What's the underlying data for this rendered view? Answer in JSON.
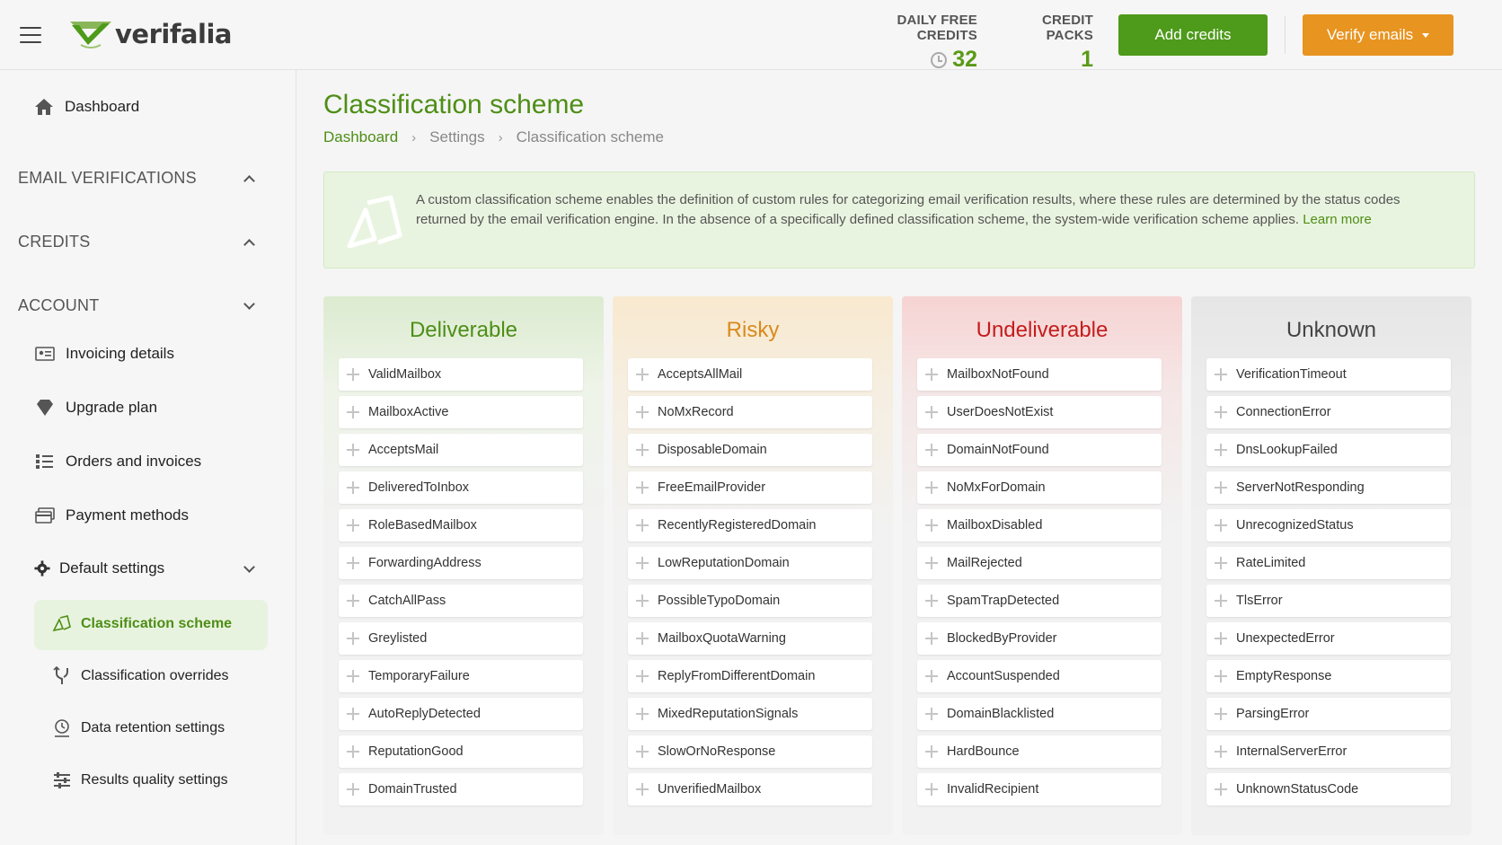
{
  "header": {
    "logo_text": "verifalia",
    "daily_credits_label": "DAILY FREE CREDITS",
    "daily_credits_value": "32",
    "credit_packs_label": "CREDIT PACKS",
    "credit_packs_value": "1",
    "add_credits_label": "Add credits",
    "verify_emails_label": "Verify emails",
    "accent_green": "#4e9a1a",
    "accent_orange": "#e89420"
  },
  "sidebar": {
    "dashboard": "Dashboard",
    "sections": {
      "email_verifications": "EMAIL VERIFICATIONS",
      "credits": "CREDITS",
      "account": "ACCOUNT"
    },
    "account_items": {
      "invoicing": "Invoicing details",
      "upgrade": "Upgrade plan",
      "orders": "Orders and invoices",
      "payment": "Payment methods",
      "default_settings": "Default settings"
    },
    "settings_items": {
      "classification_scheme": "Classification scheme",
      "classification_overrides": "Classification overrides",
      "data_retention": "Data retention settings",
      "results_quality": "Results quality settings"
    }
  },
  "main": {
    "title": "Classification scheme",
    "breadcrumb": [
      "Dashboard",
      "Settings",
      "Classification scheme"
    ],
    "info_text": "A custom classification scheme enables the definition of custom rules for categorizing email verification results, where these rules are determined by the status codes returned by the email verification engine. In the absence of a specifically defined classification scheme, the system-wide verification scheme applies.",
    "learn_more": "Learn more"
  },
  "columns": [
    {
      "title": "Deliverable",
      "color": "#4e8e16",
      "items": [
        "ValidMailbox",
        "MailboxActive",
        "AcceptsMail",
        "DeliveredToInbox",
        "RoleBasedMailbox",
        "ForwardingAddress",
        "CatchAllPass",
        "Greylisted",
        "TemporaryFailure",
        "AutoReplyDetected",
        "ReputationGood",
        "DomainTrusted"
      ]
    },
    {
      "title": "Risky",
      "color": "#d98a1c",
      "items": [
        "AcceptsAllMail",
        "NoMxRecord",
        "DisposableDomain",
        "FreeEmailProvider",
        "RecentlyRegisteredDomain",
        "LowReputationDomain",
        "PossibleTypoDomain",
        "MailboxQuotaWarning",
        "ReplyFromDifferentDomain",
        "MixedReputationSignals",
        "SlowOrNoResponse",
        "UnverifiedMailbox"
      ]
    },
    {
      "title": "Undeliverable",
      "color": "#c41d1d",
      "items": [
        "MailboxNotFound",
        "UserDoesNotExist",
        "DomainNotFound",
        "NoMxForDomain",
        "MailboxDisabled",
        "MailRejected",
        "SpamTrapDetected",
        "BlockedByProvider",
        "AccountSuspended",
        "DomainBlacklisted",
        "HardBounce",
        "InvalidRecipient"
      ]
    },
    {
      "title": "Unknown",
      "color": "#444444",
      "items": [
        "VerificationTimeout",
        "ConnectionError",
        "DnsLookupFailed",
        "ServerNotResponding",
        "UnrecognizedStatus",
        "RateLimited",
        "TlsError",
        "UnexpectedError",
        "EmptyResponse",
        "ParsingError",
        "InternalServerError",
        "UnknownStatusCode"
      ]
    }
  ]
}
